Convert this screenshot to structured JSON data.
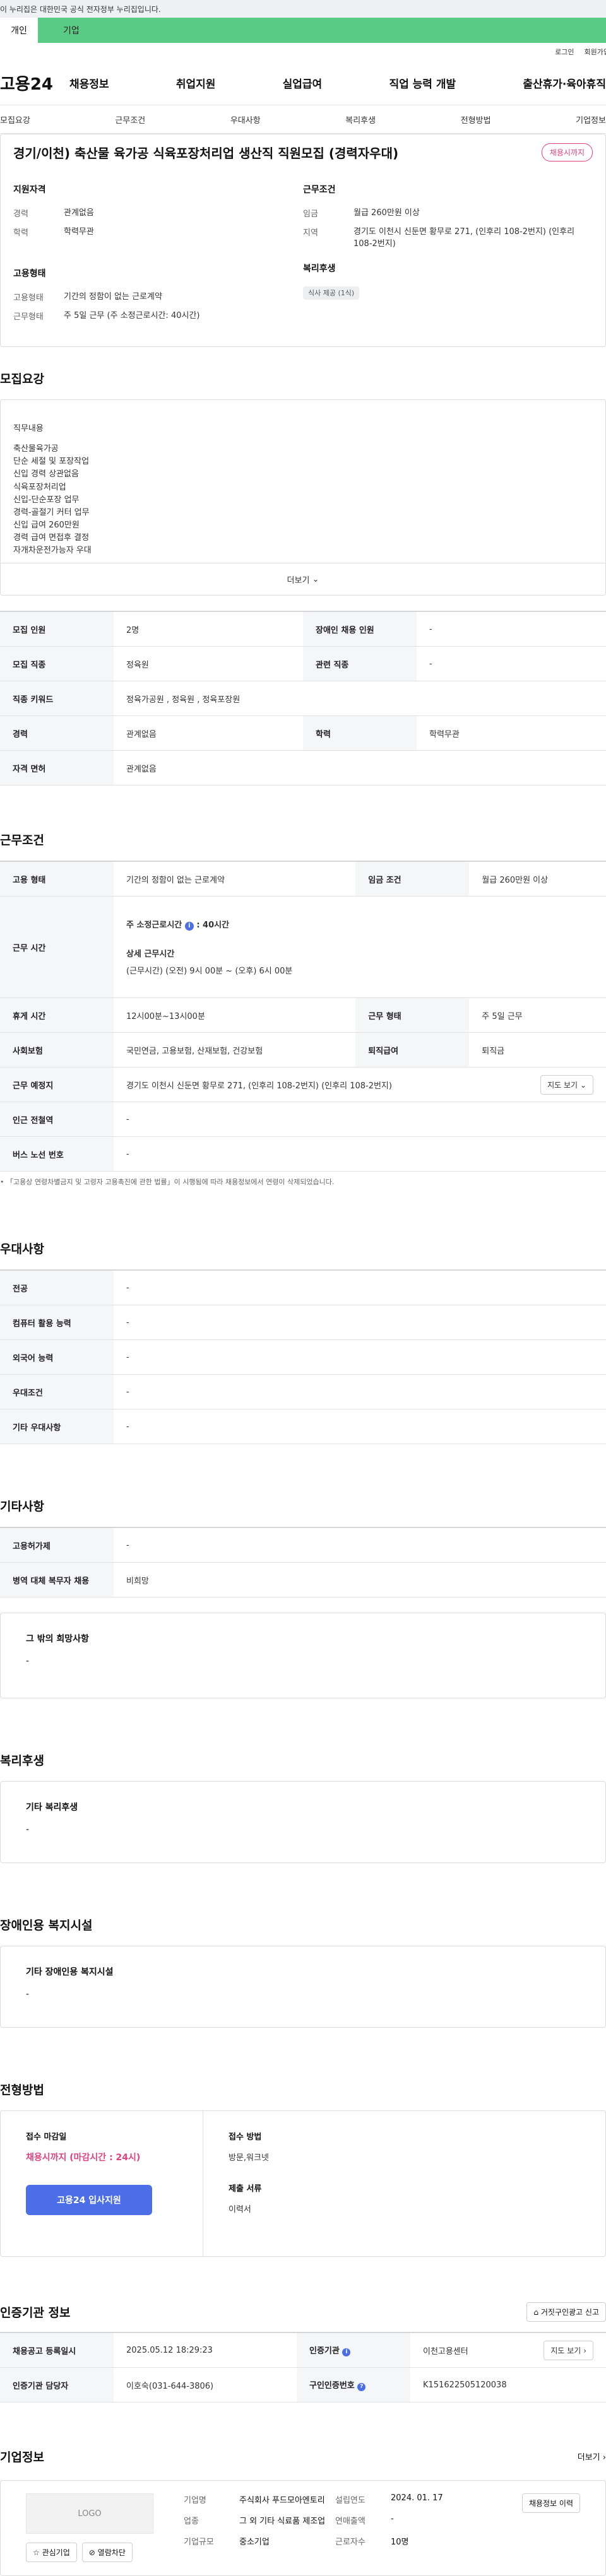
{
  "gov_banner": "이 누리집은 대한민국 공식 전자정부 누리집입니다.",
  "top_tabs": {
    "left": "개인",
    "right": "기업"
  },
  "util": {
    "login": "로그인",
    "join": "회원가입"
  },
  "logo": "고용24",
  "gnb": [
    "채용정보",
    "취업지원",
    "실업급여",
    "직업 능력 개발",
    "출산휴가·육아휴직"
  ],
  "subnav": [
    "모집요강",
    "근무조건",
    "우대사항",
    "복리후생",
    "전형방법",
    "기업정보"
  ],
  "job": {
    "title": "경기/이천) 축산물 육가공 식육포장처리업 생산직 직원모집 (경력자우대)",
    "badge": "채용시까지",
    "qual_h": "지원자격",
    "exp_k": "경력",
    "exp_v": "관계없음",
    "edu_k": "학력",
    "edu_v": "학력무관",
    "cond_h": "근무조건",
    "wage_k": "임금",
    "wage_v": "월급 260만원 이상",
    "region_k": "지역",
    "region_v": "경기도 이천시 신둔면 황무로 271, (인후리 108-2번지) (인후리 108-2번지)",
    "emp_h": "고용형태",
    "emp_k": "고용형태",
    "emp_v": "기간의 정함이 없는 근로계약",
    "work_k": "근무형태",
    "work_v": "주 5일 근무 (주 소정근로시간: 40시간)",
    "welfare_h": "복리후생",
    "welfare_pill": "식사 제공 (1식)"
  },
  "recruit": {
    "title": "모집요강",
    "desc_label": "직무내용",
    "desc_lines": [
      "축산물육가공",
      "단순 세절 및 포장작업",
      "신입 경력 상관없음",
      "식육포장처리업",
      "신입-단순포장 업무",
      "경력-골절기 커터 업무",
      "신입 급여 260만원",
      "경력 급여 면접후 결정",
      "자개차운전가능자 우대"
    ],
    "more": "더보기",
    "rows": [
      {
        "k1": "모집 인원",
        "v1": "2명",
        "k2": "장애인 채용 인원",
        "v2": "-"
      },
      {
        "k1": "모집 직종",
        "v1": "정육원",
        "k2": "관련 직종",
        "v2": "-"
      },
      {
        "k1": "직종 키워드",
        "v1": "정육가공원 , 정육원 , 정육포장원"
      },
      {
        "k1": "경력",
        "v1": "관계없음",
        "k2": "학력",
        "v2": "학력무관"
      },
      {
        "k1": "자격 면허",
        "v1": "관계없음"
      }
    ]
  },
  "condition": {
    "title": "근무조건",
    "emp_k": "고용 형태",
    "emp_v": "기간의 정함이 없는 근로계약",
    "wage_k": "임금 조건",
    "wage_v": "월급 260만원 이상",
    "time_k": "근무 시간",
    "time_main": "주 소정근로시간",
    "time_main_v": ": 40시간",
    "time_detail_h": "상세 근무시간",
    "time_detail_v": "(근무시간) (오전) 9시 00분 ~ (오후) 6시 00분",
    "rest_k": "휴게 시간",
    "rest_v": "12시00분~13시00분",
    "form_k": "근무 형태",
    "form_v": "주 5일 근무",
    "ins_k": "사회보험",
    "ins_v": "국민연금, 고용보험, 산재보험, 건강보험",
    "ret_k": "퇴직급여",
    "ret_v": "퇴직금",
    "loc_k": "근무 예정지",
    "loc_v": "경기도 이천시 신둔면 황무로 271, (인후리 108-2번지) (인후리 108-2번지)",
    "map_btn": "지도 보기",
    "subway_k": "인근 전철역",
    "subway_v": "-",
    "bus_k": "버스 노선 번호",
    "bus_v": "-",
    "note": "「고용상 연령차별금지 및 고령자 고용촉진에 관한 법률」이 시행됨에 따라 채용정보에서 연령이 삭제되었습니다."
  },
  "prefer": {
    "title": "우대사항",
    "rows": [
      [
        "전공",
        "-"
      ],
      [
        "컴퓨터 활용 능력",
        "-"
      ],
      [
        "외국어 능력",
        "-"
      ],
      [
        "우대조건",
        "-"
      ],
      [
        "기타 우대사항",
        "-"
      ]
    ]
  },
  "etc": {
    "title": "기타사항",
    "rows": [
      [
        "고용허가제",
        "-"
      ],
      [
        "병역 대체 복무자 채용",
        "비희망"
      ]
    ],
    "box_label": "그 밖의 희망사항",
    "box_value": "-"
  },
  "welfare": {
    "title": "복리후생",
    "label": "기타 복리후생",
    "value": "-"
  },
  "disabled": {
    "title": "장애인용 복지시설",
    "label": "기타 장애인용 복지시설",
    "value": "-"
  },
  "selection": {
    "title": "전형방법",
    "deadline_l": "접수 마감일",
    "deadline_v": "채용시까지 (마감시간 : 24시)",
    "apply_btn": "고용24 입사지원",
    "method_l": "접수 방법",
    "method_v": "방문,워크넷",
    "docs_l": "제출 서류",
    "docs_v": "이력서"
  },
  "agency": {
    "title": "인증기관 정보",
    "report_btn": "거짓구인광고 신고",
    "reg_k": "채용공고 등록일시",
    "reg_v": "2025.05.12 18:29:23",
    "org_k": "인증기관",
    "org_v": "이천고용센터",
    "map_btn": "지도 보기",
    "mgr_k": "인증기관 담당자",
    "mgr_v": "이호숙(031-644-3806)",
    "num_k": "구인인증번호",
    "num_v": "K151622505120038"
  },
  "company": {
    "title": "기업정보",
    "more": "더보기",
    "logo": "LOGO",
    "fav_btn": "관심기업",
    "block_btn": "열람차단",
    "name_k": "기업명",
    "name_v": "주식회사 푸드모아엔토리",
    "ind_k": "업종",
    "ind_v": "그 외 기타 식료품 제조업",
    "size_k": "기업규모",
    "size_v": "중소기업",
    "est_k": "설립연도",
    "est_v": "2024. 01. 17",
    "sales_k": "연매출액",
    "sales_v": "-",
    "emp_k": "근로자수",
    "emp_v": "10명",
    "hire_btn": "채용정보 이력"
  }
}
